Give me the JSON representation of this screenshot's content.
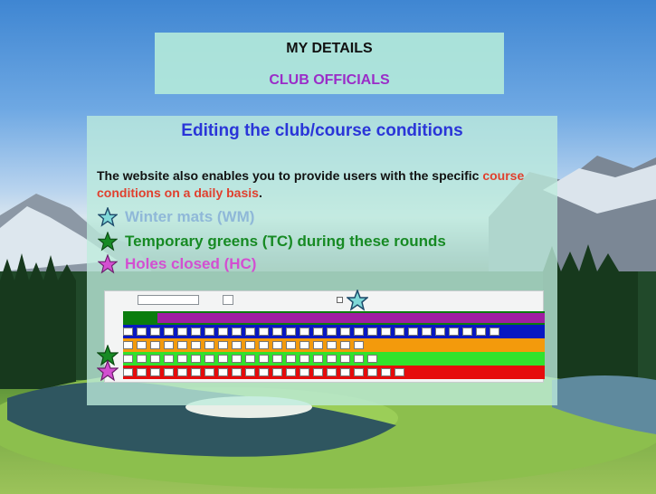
{
  "header": {
    "title": "MY DETAILS",
    "subtitle": "CLUB OFFICIALS"
  },
  "panel": {
    "title": "Editing the club/course conditions",
    "intro_text": "The website also enables you to provide users with the specific ",
    "intro_highlight": "course conditions on a daily basis",
    "intro_end": "."
  },
  "legend": [
    {
      "label": "Winter mats (WM)",
      "icon": "star-outline-icon",
      "color": "#8fb8d8"
    },
    {
      "label": "Temporary greens (TC) during these rounds",
      "icon": "star-icon",
      "color": "#178a24"
    },
    {
      "label": "Holes closed (HC)",
      "icon": "star-icon",
      "color": "#d34fd1"
    }
  ],
  "colors": {
    "header_bg": "#b2e8da",
    "panel_bg": "#beecdc",
    "title_blue": "#2a35d8",
    "subtitle_purple": "#9a2dc8",
    "highlight_red": "#e0402e"
  }
}
